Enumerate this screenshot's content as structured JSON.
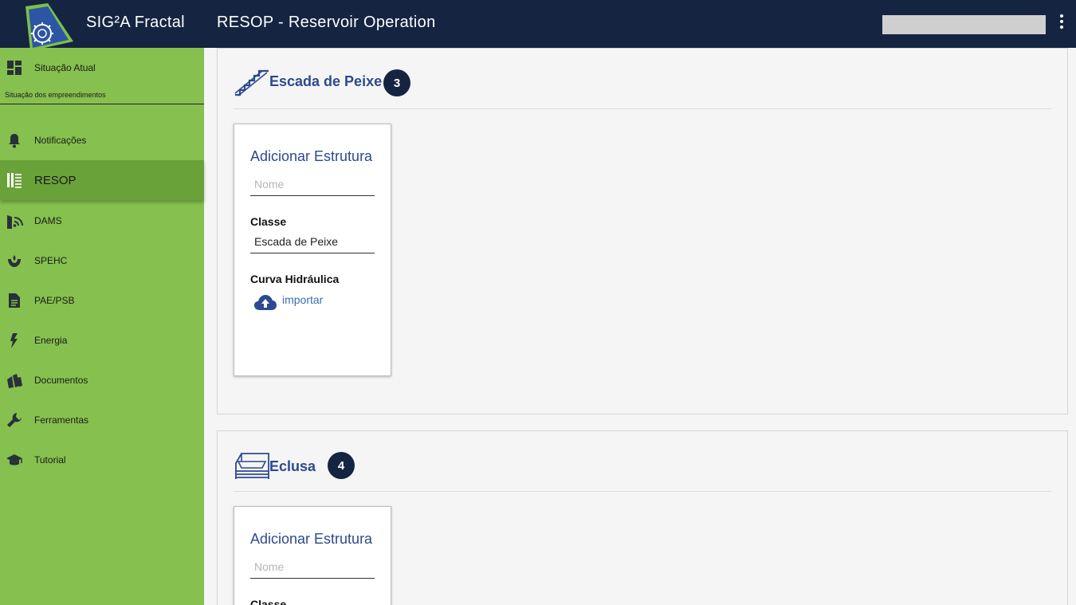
{
  "header": {
    "app_name": "SIG²A Fractal",
    "page_title": "RESOP - Reservoir Operation"
  },
  "sidebar": {
    "section_caption": "Situação dos empreendimentos",
    "items": [
      {
        "label": "Situação Atual",
        "icon": "dashboard-icon"
      },
      {
        "label": "Notificações",
        "icon": "bell-icon"
      },
      {
        "label": "RESOP",
        "icon": "dam-gate-icon",
        "active": true
      },
      {
        "label": "DAMS",
        "icon": "dam-signal-icon"
      },
      {
        "label": "SPEHC",
        "icon": "hydro-icon"
      },
      {
        "label": "PAE/PSB",
        "icon": "document-icon"
      },
      {
        "label": "Energia",
        "icon": "lightning-icon"
      },
      {
        "label": "Documentos",
        "icon": "books-icon"
      },
      {
        "label": "Ferramentas",
        "icon": "wrench-icon"
      },
      {
        "label": "Tutorial",
        "icon": "graduation-cap-icon"
      }
    ]
  },
  "sections": [
    {
      "title": "Escada de Peixe",
      "count": "3",
      "icon": "fish-ladder-icon",
      "card": {
        "title": "Adicionar Estrutura",
        "name_placeholder": "Nome",
        "class_label": "Classe",
        "class_value": "Escada de Peixe",
        "curve_label": "Curva Hidráulica",
        "import_label": "importar"
      }
    },
    {
      "title": "Eclusa",
      "count": "4",
      "icon": "lock-gate-icon",
      "card": {
        "title": "Adicionar Estrutura",
        "name_placeholder": "Nome",
        "class_label": "Classe"
      }
    }
  ],
  "colors": {
    "topbar": "#142441",
    "sidebar": "#86c04f",
    "sidebar_active": "#6aa23a",
    "accent": "#2d4a8f"
  }
}
